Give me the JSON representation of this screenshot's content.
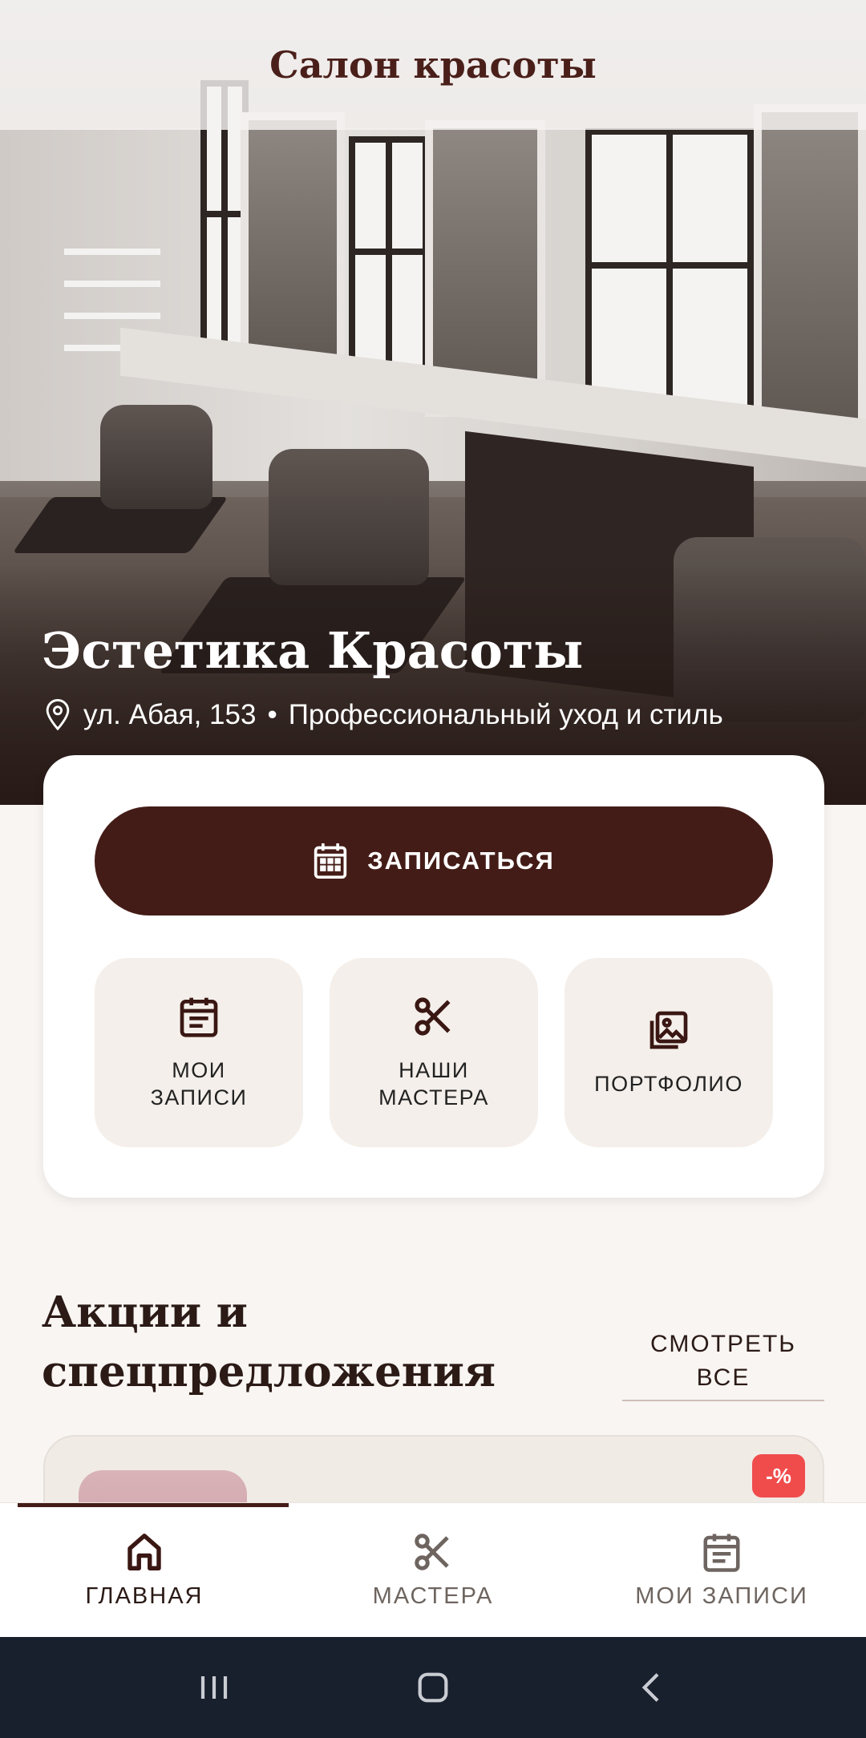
{
  "app": {
    "title": "Салон красоты"
  },
  "salon": {
    "name": "Эстетика Красоты",
    "address": "ул. Абая, 153",
    "separator": "•",
    "tagline": "Профессиональный уход и стиль"
  },
  "actions": {
    "book_label": "ЗАПИСАТЬСЯ",
    "tiles": [
      {
        "label": "МОИ\nЗАПИСИ",
        "icon": "calendar-list-icon"
      },
      {
        "label": "НАШИ\nМАСТЕРА",
        "icon": "scissors-icon"
      },
      {
        "label": "ПОРТФОЛИО",
        "icon": "gallery-icon"
      }
    ]
  },
  "promos": {
    "title": "Акции и спецпредложения",
    "see_all": "СМОТРЕТЬ\nВСЕ",
    "badge": "-%"
  },
  "bottom_nav": [
    {
      "label": "ГЛАВНАЯ",
      "icon": "home-icon",
      "active": true
    },
    {
      "label": "МАСТЕРА",
      "icon": "scissors-icon",
      "active": false
    },
    {
      "label": "МОИ ЗАПИСИ",
      "icon": "calendar-list-icon",
      "active": false
    }
  ],
  "colors": {
    "primary": "#441c17",
    "background": "#f8f5f2",
    "tile": "#f4efea",
    "badge": "#f04c4c",
    "system_nav": "#18202e"
  }
}
